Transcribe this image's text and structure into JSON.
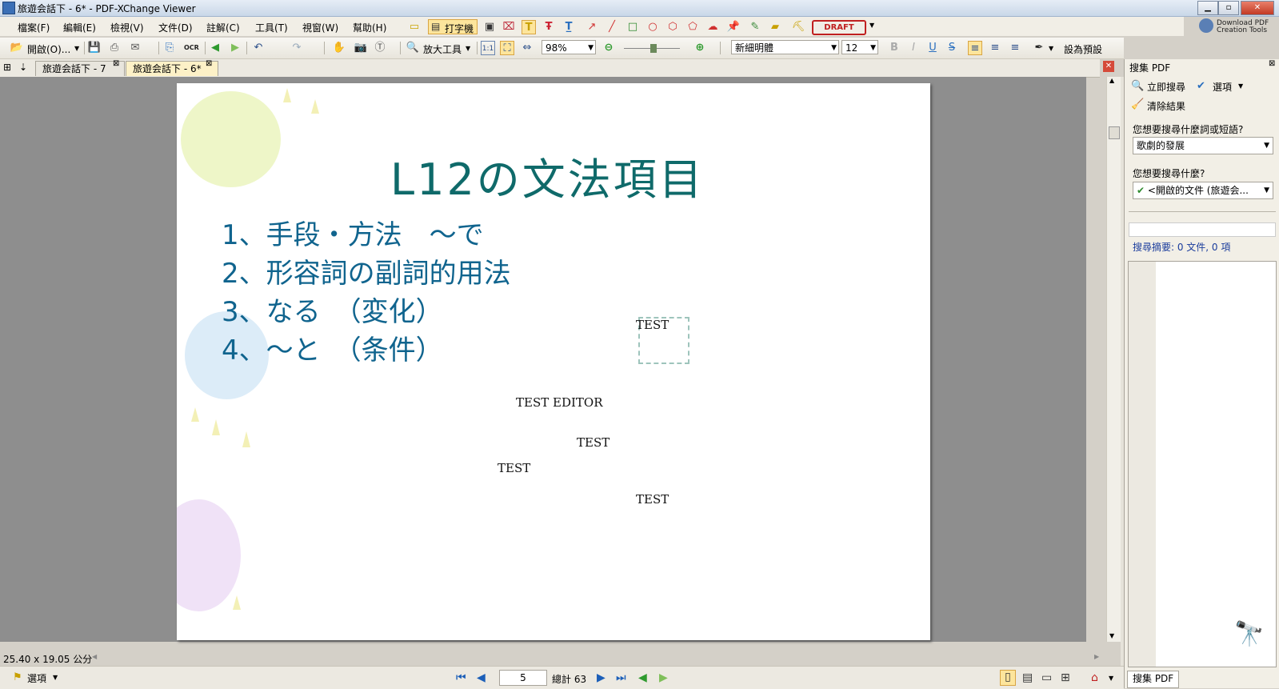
{
  "window": {
    "title": "旅遊会話下 - 6* - PDF-XChange Viewer"
  },
  "menu": [
    "檔案(F)",
    "編輯(E)",
    "檢視(V)",
    "文件(D)",
    "註解(C)",
    "工具(T)",
    "視窗(W)",
    "幫助(H)"
  ],
  "toolbar1": {
    "typewriter_label": "打字機",
    "draft_stamp": "DRAFT"
  },
  "download_button": {
    "line1": "Download PDF",
    "line2": "Creation Tools"
  },
  "toolbar2": {
    "open_label": "開啟(O)...",
    "ocr_label": "OCR",
    "zoom_tool_label": "放大工具",
    "zoom_value": "98%",
    "font_name": "新細明體",
    "font_size": "12",
    "set_default_label": "設為預設"
  },
  "tabs": [
    {
      "label": "旅遊会話下 - 7"
    },
    {
      "label": "旅遊会話下 - 6*"
    }
  ],
  "pdf": {
    "title": "L12の文法項目",
    "lines": [
      "1、手段・方法　～で",
      "2、形容詞の副詞的用法",
      "3、なる　（変化）",
      "4、～と　（条件）"
    ],
    "annotations": {
      "stamp_text": "TEST",
      "editor_text": "TEST EDITOR",
      "test1": "TEST",
      "test2": "TEST",
      "test3": "TEST"
    }
  },
  "search_panel": {
    "title": "搜集 PDF",
    "search_now": "立即搜尋",
    "options": "選項",
    "clear_results": "清除結果",
    "question1": "您想要搜尋什麼詞或短語?",
    "query_value": "歌劇的發展",
    "question2": "您想要搜尋什麼?",
    "scope_value": "<開啟的文件 (旅遊会...",
    "summary": "搜尋摘要: 0 文件, 0 項",
    "bottom_tab": "搜集 PDF"
  },
  "status": {
    "page_size": "25.40 x 19.05 公分",
    "options_label": "選項",
    "current_page": "5",
    "total_pages": "總計 63"
  },
  "colors": {
    "pdf_title": "#0f6a6a",
    "pdf_body": "#10648e",
    "panel_link": "#1a3c9c"
  }
}
